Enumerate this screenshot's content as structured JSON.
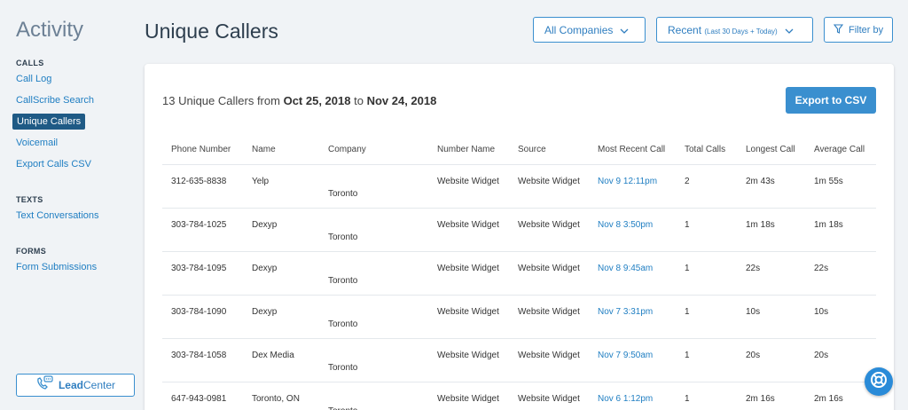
{
  "sidebar": {
    "title": "Activity",
    "sections": [
      {
        "heading": "CALLS",
        "items": [
          "Call Log",
          "CallScribe Search",
          "Unique Callers",
          "Voicemail",
          "Export Calls CSV"
        ]
      },
      {
        "heading": "TEXTS",
        "items": [
          "Text Conversations"
        ]
      },
      {
        "heading": "FORMS",
        "items": [
          "Form Submissions"
        ]
      }
    ],
    "active_item": "Unique Callers",
    "leadcenter_bold": "Lead",
    "leadcenter_rest": "Center"
  },
  "header": {
    "title": "Unique Callers",
    "companies_label": "All Companies",
    "recent_label": "Recent",
    "recent_sub": "(Last 30 Days + Today)",
    "filter_label": "Filter by"
  },
  "summary": {
    "prefix": "13 Unique Callers from",
    "from": "Oct 25, 2018",
    "mid": "to",
    "to": "Nov 24, 2018"
  },
  "export_label": "Export to CSV",
  "table": {
    "columns": [
      "Phone Number",
      "Name",
      "Company",
      "Number Name",
      "Source",
      "Most Recent Call",
      "Total Calls",
      "Longest Call",
      "Average Call"
    ],
    "rows": [
      [
        "312-635-8838",
        "Yelp",
        "Toronto",
        "Website Widget",
        "Website Widget",
        "Nov 9 12:11pm",
        "2",
        "2m 43s",
        "1m 55s"
      ],
      [
        "303-784-1025",
        "Dexyp",
        "Toronto",
        "Website Widget",
        "Website Widget",
        "Nov 8 3:50pm",
        "1",
        "1m 18s",
        "1m 18s"
      ],
      [
        "303-784-1095",
        "Dexyp",
        "Toronto",
        "Website Widget",
        "Website Widget",
        "Nov 8 9:45am",
        "1",
        "22s",
        "22s"
      ],
      [
        "303-784-1090",
        "Dexyp",
        "Toronto",
        "Website Widget",
        "Website Widget",
        "Nov 7 3:31pm",
        "1",
        "10s",
        "10s"
      ],
      [
        "303-784-1058",
        "Dex Media",
        "Toronto",
        "Website Widget",
        "Website Widget",
        "Nov 7 9:50am",
        "1",
        "20s",
        "20s"
      ],
      [
        "647-943-0981",
        "Toronto, ON",
        "Toronto",
        "Website Widget",
        "Website Widget",
        "Nov 6 1:12pm",
        "1",
        "2m 16s",
        "2m 16s"
      ]
    ]
  },
  "colors": {
    "accent": "#3a8fcf",
    "link": "#1f7ec2",
    "active_bg": "#1f5a85"
  }
}
